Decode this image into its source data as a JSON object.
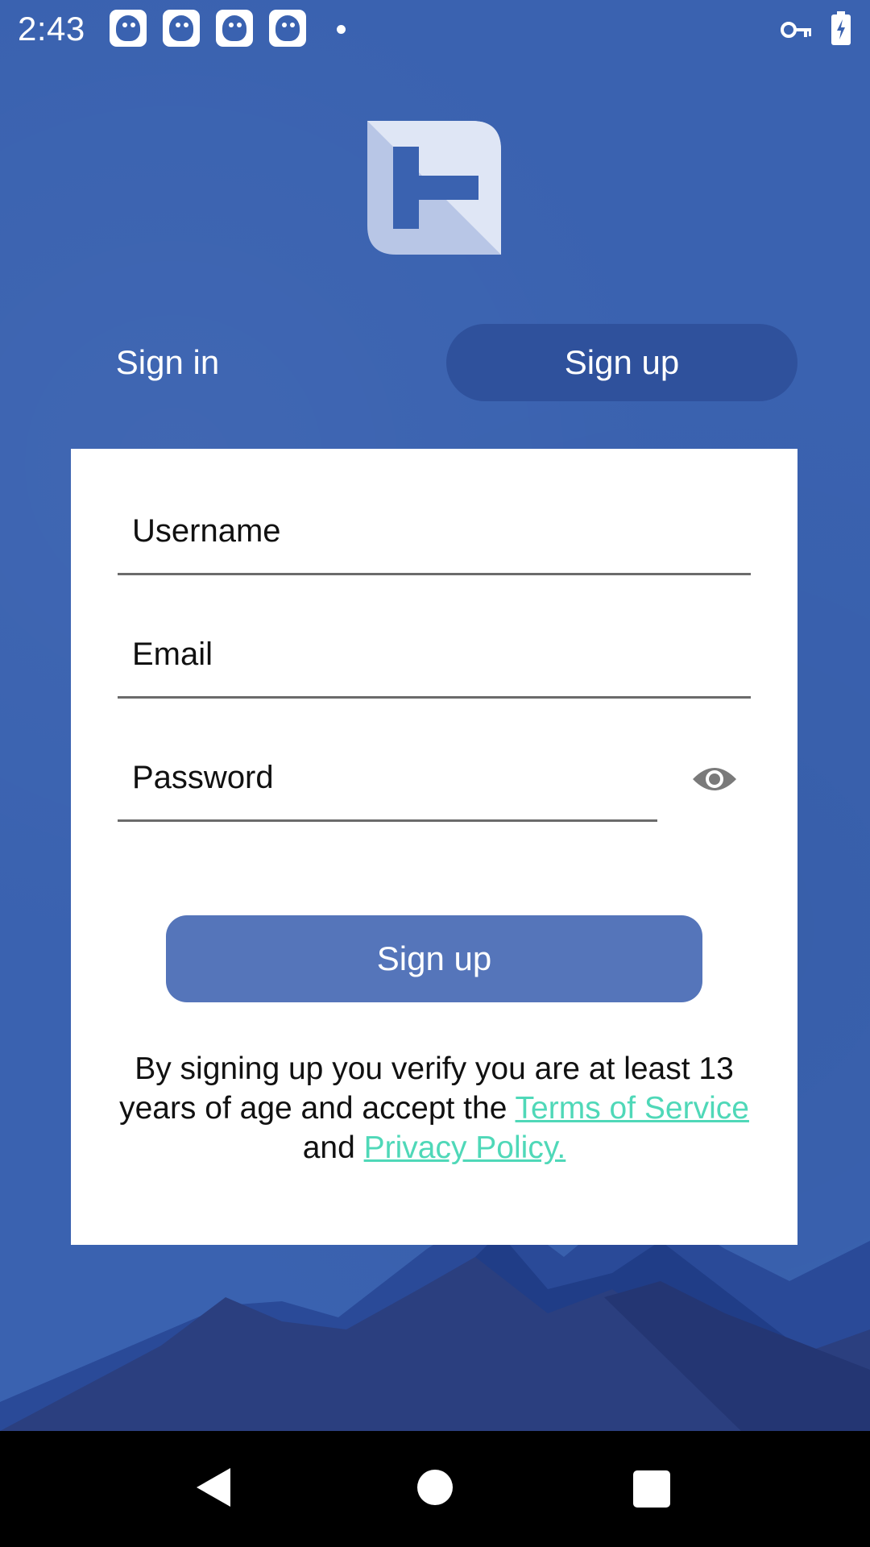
{
  "status_bar": {
    "time": "2:43",
    "notification_icons": [
      "bird-app-icon",
      "bird-app-icon",
      "bird-app-icon",
      "bird-app-icon"
    ],
    "icons": [
      "vpn-key-icon",
      "battery-charging-icon"
    ]
  },
  "tabs": {
    "signin_label": "Sign in",
    "signup_label": "Sign up",
    "active": "signup"
  },
  "form": {
    "username_placeholder": "Username",
    "email_placeholder": "Email",
    "password_placeholder": "Password",
    "submit_label": "Sign up"
  },
  "terms": {
    "text_before": "By signing up you verify you are at least 13 years of age and accept the ",
    "terms_link": "Terms of Service",
    "text_middle": " and ",
    "privacy_link": "Privacy Policy."
  },
  "colors": {
    "background": "#3a62b0",
    "active_tab": "#2f519c",
    "button": "#5575ba",
    "link": "#4fd8b8"
  }
}
